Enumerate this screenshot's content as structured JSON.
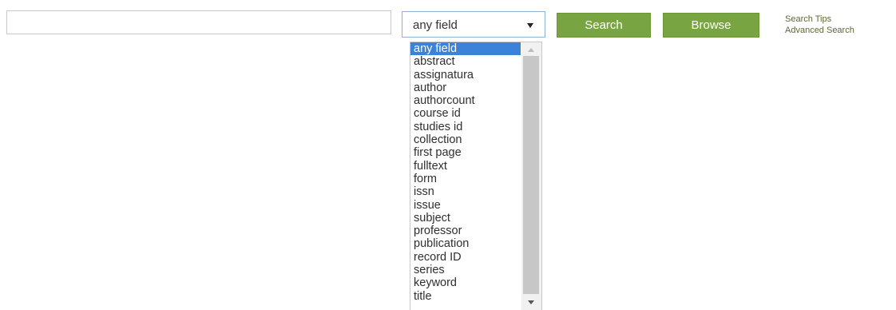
{
  "search": {
    "value": "",
    "placeholder": ""
  },
  "field_select": {
    "selected": "any field",
    "options": [
      "any field",
      "abstract",
      "assignatura",
      "author",
      "authorcount",
      "course id",
      "studies id",
      "collection",
      "first page",
      "fulltext",
      "form",
      "issn",
      "issue",
      "subject",
      "professor",
      "publication",
      "record ID",
      "series",
      "keyword",
      "title"
    ]
  },
  "buttons": {
    "search_label": "Search",
    "browse_label": "Browse"
  },
  "links": {
    "search_tips": "Search Tips",
    "advanced_search": "Advanced Search"
  },
  "colors": {
    "button_green": "#78a542",
    "selected_option": "#3b82d9",
    "link_color": "#5a6a2f"
  }
}
